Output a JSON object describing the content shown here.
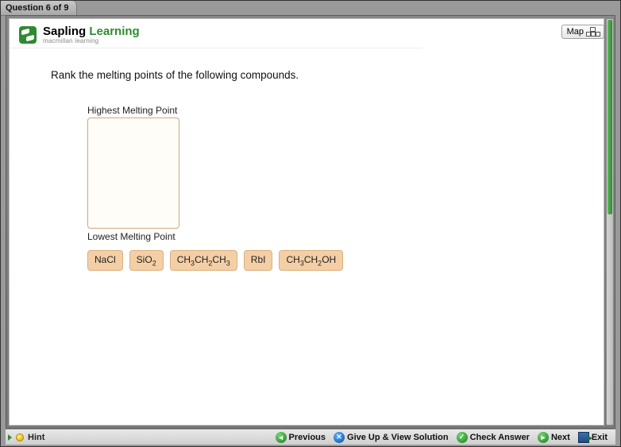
{
  "header": {
    "question_counter": "Question 6 of 9",
    "map_label": "Map"
  },
  "brand": {
    "title_a": "Sapling ",
    "title_b": "Learning",
    "subtitle": "macmillan learning"
  },
  "question": {
    "prompt": "Rank the melting points of the following compounds."
  },
  "rank": {
    "top_label": "Highest Melting Point",
    "bottom_label": "Lowest Melting Point"
  },
  "compounds": [
    {
      "formula_html": "NaCl"
    },
    {
      "formula_html": "SiO<sub>2</sub>"
    },
    {
      "formula_html": "CH<sub>3</sub>CH<sub>2</sub>CH<sub>3</sub>"
    },
    {
      "formula_html": "RbI"
    },
    {
      "formula_html": "CH<sub>3</sub>CH<sub>2</sub>OH"
    }
  ],
  "footer": {
    "hint": "Hint",
    "previous": "Previous",
    "give_up": "Give Up & View Solution",
    "check": "Check Answer",
    "next": "Next",
    "exit": "Exit"
  }
}
